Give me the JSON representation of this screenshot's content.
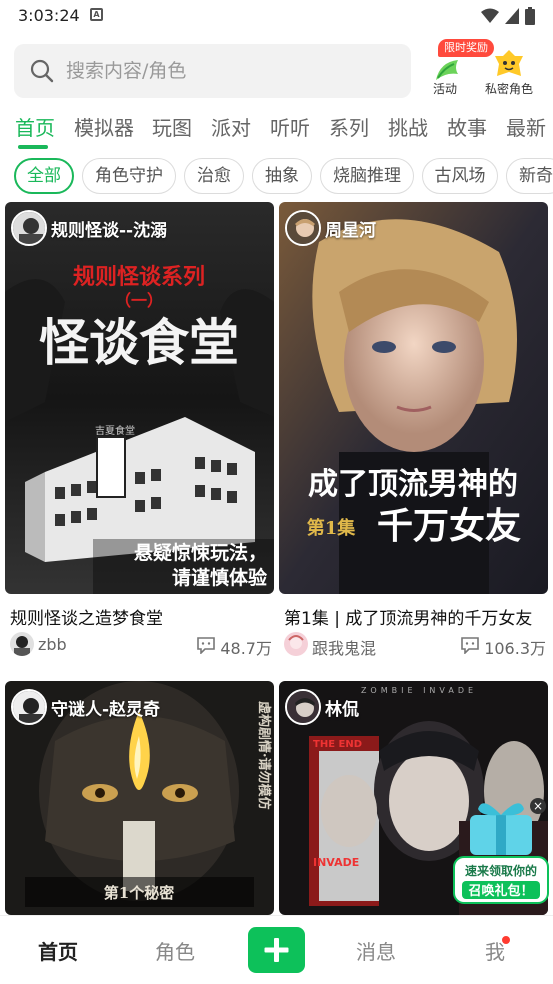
{
  "status_bar": {
    "time": "3:03:24"
  },
  "search": {
    "placeholder": "搜索内容/角色"
  },
  "activities": {
    "badge": "限时奖励",
    "event_label": "活动",
    "secret_label": "私密角色"
  },
  "tabs": [
    "首页",
    "模拟器",
    "玩图",
    "派对",
    "听听",
    "系列",
    "挑战",
    "故事",
    "最新"
  ],
  "chips": [
    "全部",
    "角色守护",
    "治愈",
    "抽象",
    "烧脑推理",
    "古风场",
    "新奇"
  ],
  "cards": [
    {
      "author": "规则怪谈--沈溺",
      "title": "规则怪谈之造梦食堂",
      "user": "zbb",
      "count": "48.7万",
      "cover_text": {
        "top": "规则怪谈系列",
        "sub": "（一）",
        "main": "怪谈食堂",
        "sign": "吉夏食堂",
        "line1": "悬疑惊悚玩法，",
        "line2": "请谨慎体验"
      }
    },
    {
      "author": "周星河",
      "title": "第1集 | 成了顶流男神的千万女友",
      "user": "跟我鬼混",
      "count": "106.3万",
      "cover_text": {
        "main": "成了顶流男神的",
        "ep": "第1集",
        "sub": "千万女友"
      }
    },
    {
      "author": "守谜人-赵灵奇",
      "cover_text": {
        "side": "虚构剧情·请勿模仿",
        "bottom": "第1个秘密"
      }
    },
    {
      "author": "林侃",
      "cover_text": {
        "top": "ZOMBIE INVADE",
        "the_end": "THE END",
        "invade": "INVADE"
      }
    }
  ],
  "gift": {
    "line1": "速来领取你的",
    "line2": "召唤礼包！"
  },
  "bottom_nav": {
    "home": "首页",
    "role": "角色",
    "message": "消息",
    "me": "我"
  },
  "colors": {
    "accent": "#1ab85a",
    "plus": "#0dc15a",
    "badge": "#ff4a3d"
  }
}
